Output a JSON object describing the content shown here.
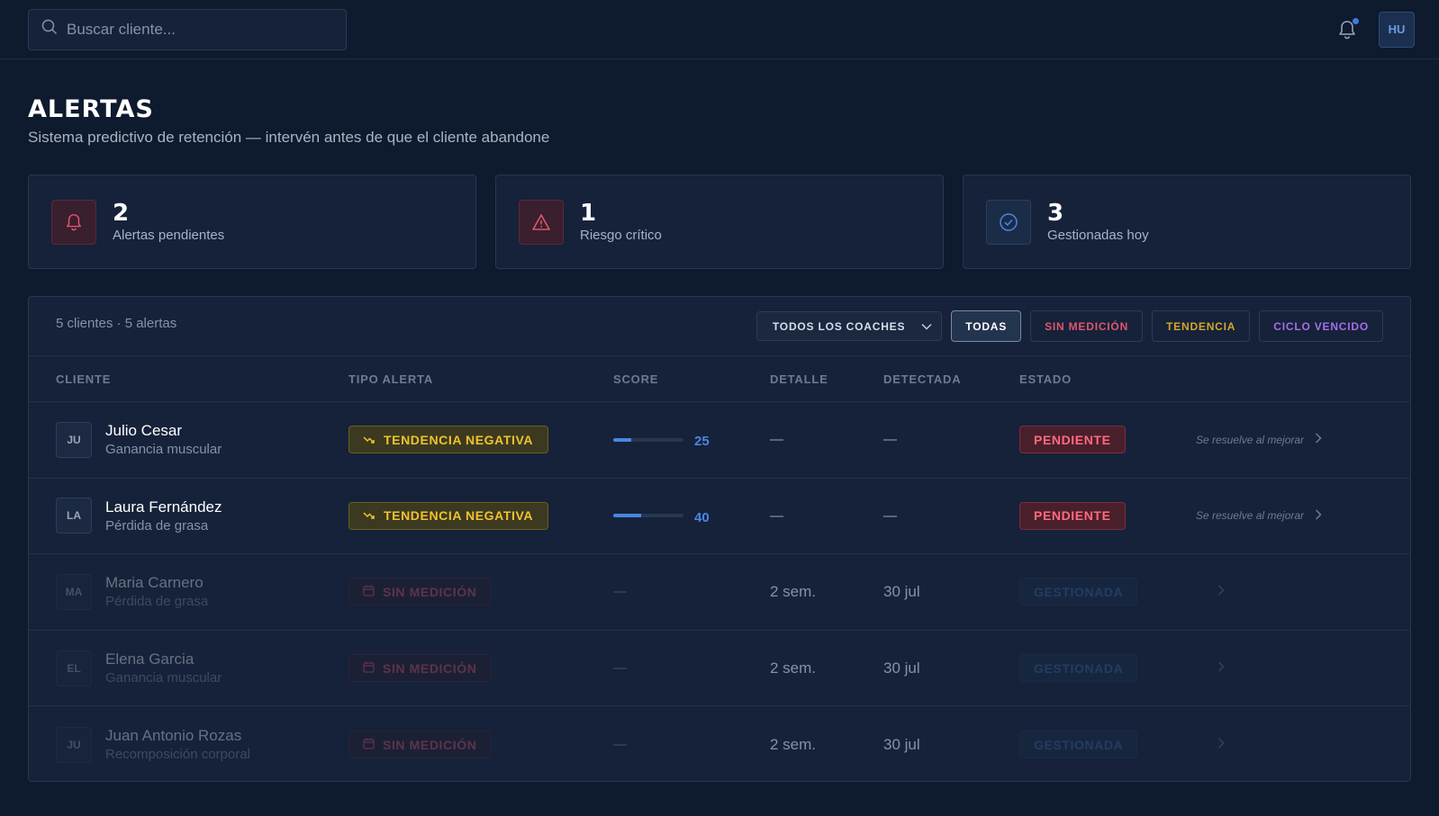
{
  "search": {
    "placeholder": "Buscar cliente..."
  },
  "user": {
    "initials": "HU"
  },
  "header": {
    "title": "ALERTAS",
    "subtitle": "Sistema predictivo de retención — intervén antes de que el cliente abandone"
  },
  "stats": [
    {
      "value": "2",
      "label": "Alertas pendientes",
      "icon": "bell-icon",
      "tone": "red"
    },
    {
      "value": "1",
      "label": "Riesgo crítico",
      "icon": "warning-icon",
      "tone": "red"
    },
    {
      "value": "3",
      "label": "Gestionadas hoy",
      "icon": "check-circle-icon",
      "tone": "blue"
    }
  ],
  "toolbar": {
    "count": "5 clientes · 5 alertas",
    "coach_select": "TODOS LOS COACHES",
    "filters": [
      "TODAS",
      "SIN MEDICIÓN",
      "TENDENCIA",
      "CICLO VENCIDO"
    ]
  },
  "table": {
    "columns": [
      "CLIENTE",
      "TIPO ALERTA",
      "SCORE",
      "DETALLE",
      "DETECTADA",
      "ESTADO"
    ],
    "rows": [
      {
        "initials": "JU",
        "name": "Julio Cesar",
        "goal": "Ganancia muscular",
        "type": "TENDENCIA NEGATIVA",
        "score": "25",
        "score_fraction": 0.25,
        "detail": "—",
        "detected": "—",
        "state": "PENDIENTE",
        "action": "Se resuelve al mejorar"
      },
      {
        "initials": "LA",
        "name": "Laura Fernández",
        "goal": "Pérdida de grasa",
        "type": "TENDENCIA NEGATIVA",
        "score": "40",
        "score_fraction": 0.4,
        "detail": "—",
        "detected": "—",
        "state": "PENDIENTE",
        "action": "Se resuelve al mejorar"
      },
      {
        "initials": "MA",
        "name": "Maria Carnero",
        "goal": "Pérdida de grasa",
        "type": "SIN MEDICIÓN",
        "score": "—",
        "detail": "2 sem.",
        "detected": "30 jul",
        "state": "GESTIONADA"
      },
      {
        "initials": "EL",
        "name": "Elena Garcia",
        "goal": "Ganancia muscular",
        "type": "SIN MEDICIÓN",
        "score": "—",
        "detail": "2 sem.",
        "detected": "30 jul",
        "state": "GESTIONADA"
      },
      {
        "initials": "JU",
        "name": "Juan Antonio Rozas",
        "goal": "Recomposición corporal",
        "type": "SIN MEDICIÓN",
        "score": "—",
        "detail": "2 sem.",
        "detected": "30 jul",
        "state": "GESTIONADA"
      }
    ]
  }
}
